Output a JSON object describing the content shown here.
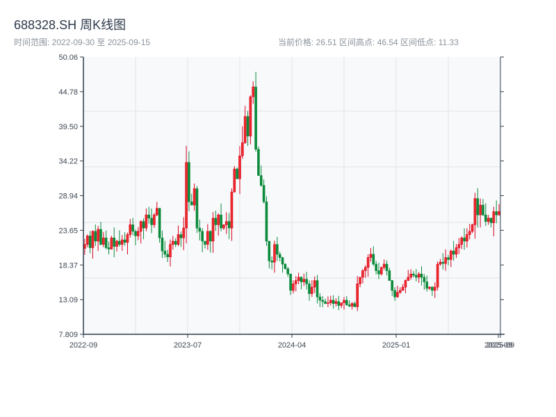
{
  "header": {
    "title": "688328.SH 周K线图",
    "range_text": "时间范围: 2022-09-30 至 2025-09-15",
    "stats_text": "当前价格: 26.51  区间高点: 46.54  区间低点: 11.33"
  },
  "chart_data": {
    "type": "candlestick",
    "title": "688328.SH 周K线图",
    "period": "weekly",
    "start": "2022-09-30",
    "end": "2025-09-15",
    "up_color": "#d9001b",
    "down_color": "#0b8a3a",
    "ylim": [
      7.809,
      50.06
    ],
    "yticks": [
      "7.809",
      "13.09",
      "18.37",
      "23.65",
      "28.94",
      "34.22",
      "39.50",
      "44.78",
      "50.06"
    ],
    "xticks": [
      "2022-09",
      "2023-07",
      "2024-04",
      "2025-01",
      "2025-09",
      "2025-09"
    ],
    "grid": true,
    "current_price": 26.51,
    "period_high": 46.54,
    "period_low": 11.33,
    "close": [
      21.5,
      22.8,
      21,
      23.5,
      22,
      23.8,
      21.5,
      22.5,
      21,
      20.8,
      22.5,
      21.2,
      22,
      21.5,
      22.2,
      21.8,
      23,
      24.5,
      23.5,
      22.8,
      23.5,
      25,
      24,
      26,
      25.5,
      24.5,
      26,
      27,
      22.5,
      20.5,
      20,
      19.6,
      21.5,
      22,
      21.5,
      23,
      22.5,
      24,
      34,
      28,
      27.5,
      30,
      24,
      23.5,
      22,
      21.5,
      23.5,
      22,
      25.5,
      24.5,
      26,
      24,
      24.5,
      25,
      24,
      29.5,
      33,
      31.5,
      35,
      37,
      41,
      38,
      44,
      45.5,
      36,
      32,
      30.5,
      28,
      22,
      19,
      18.8,
      21.5,
      20,
      19.5,
      18.5,
      17.8,
      17,
      14.5,
      15.5,
      16,
      16.5,
      15.8,
      16.2,
      15.5,
      14,
      15,
      16,
      13.5,
      13,
      12.8,
      12.5,
      12.6,
      13,
      12.5,
      12.8,
      12.2,
      12.6,
      13,
      12.3,
      12.1,
      12.5,
      12,
      15.5,
      16.5,
      17.5,
      18,
      19.5,
      20,
      18.5,
      17.5,
      17,
      18,
      18.5,
      17.5,
      16,
      14.5,
      13.5,
      14.2,
      14.5,
      15,
      16,
      16.5,
      17,
      16.8,
      16.5,
      17,
      16.5,
      15.8,
      14.8,
      15,
      14.5,
      15,
      18.5,
      18.8,
      18.6,
      19.5,
      19.2,
      20.5,
      20,
      21,
      21.5,
      22.5,
      22,
      23,
      23.5,
      24.5,
      28.5,
      26,
      27.5,
      26,
      25,
      25.5,
      24.8,
      26.5,
      26,
      26.51
    ]
  }
}
